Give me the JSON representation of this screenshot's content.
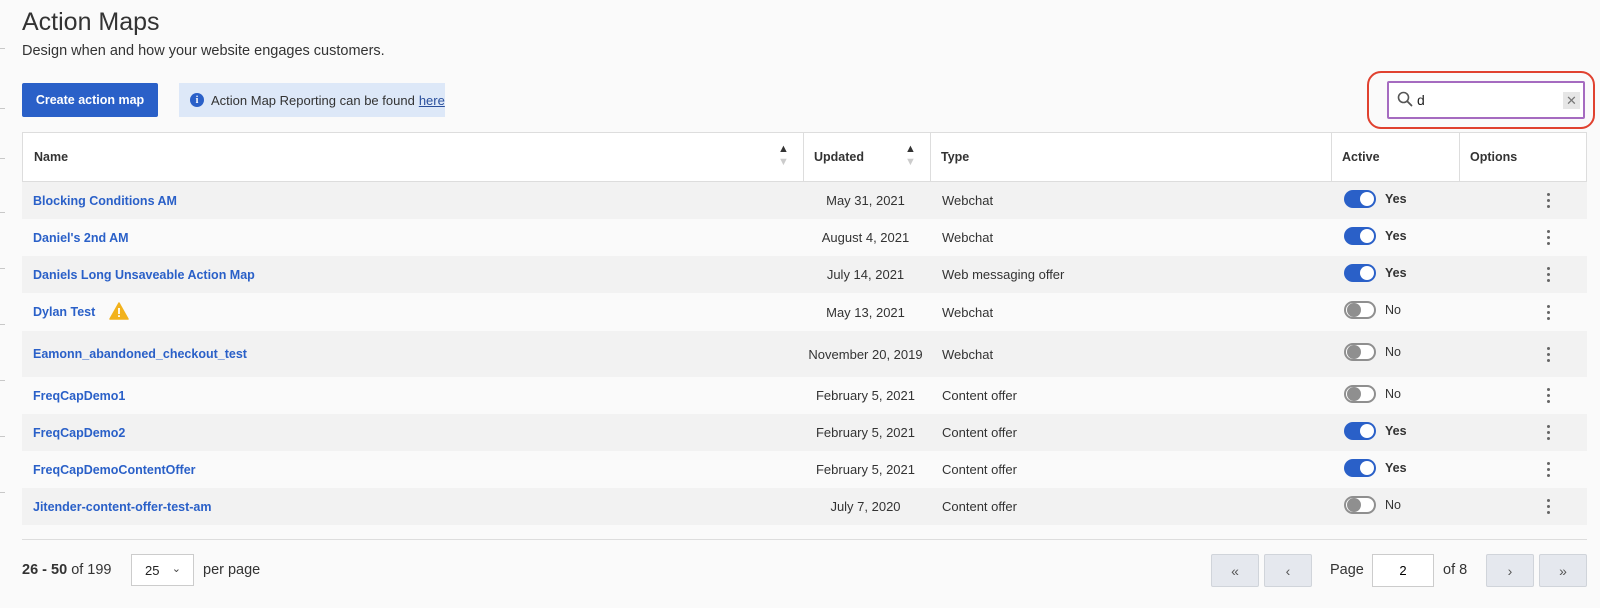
{
  "page": {
    "title": "Action Maps",
    "subtitle": "Design when and how your website engages customers."
  },
  "toolbar": {
    "create_label": "Create action map",
    "info_text": "Action Map Reporting can be found",
    "info_link": "here",
    "info_icon_glyph": "i"
  },
  "search": {
    "value": "d",
    "clear_glyph": "✕",
    "placeholder": ""
  },
  "table": {
    "headers": {
      "name": "Name",
      "updated": "Updated",
      "type": "Type",
      "active": "Active",
      "options": "Options"
    },
    "sort_up_glyph": "▲",
    "sort_down_glyph": "▼",
    "rows": [
      {
        "name": "Blocking Conditions AM",
        "updated": "May 31, 2021",
        "type": "Webchat",
        "active": true,
        "active_label": "Yes",
        "warning": false
      },
      {
        "name": "Daniel's 2nd AM",
        "updated": "August 4, 2021",
        "type": "Webchat",
        "active": true,
        "active_label": "Yes",
        "warning": false
      },
      {
        "name": "Daniels Long Unsaveable Action Map",
        "updated": "July 14, 2021",
        "type": "Web messaging offer",
        "active": true,
        "active_label": "Yes",
        "warning": false
      },
      {
        "name": "Dylan Test",
        "updated": "May 13, 2021",
        "type": "Webchat",
        "active": false,
        "active_label": "No",
        "warning": true
      },
      {
        "name": "Eamonn_abandoned_checkout_test",
        "updated": "November 20, 2019",
        "type": "Webchat",
        "active": false,
        "active_label": "No",
        "warning": false
      },
      {
        "name": "FreqCapDemo1",
        "updated": "February 5, 2021",
        "type": "Content offer",
        "active": false,
        "active_label": "No",
        "warning": false
      },
      {
        "name": "FreqCapDemo2",
        "updated": "February 5, 2021",
        "type": "Content offer",
        "active": true,
        "active_label": "Yes",
        "warning": false
      },
      {
        "name": "FreqCapDemoContentOffer",
        "updated": "February 5, 2021",
        "type": "Content offer",
        "active": true,
        "active_label": "Yes",
        "warning": false
      },
      {
        "name": "Jitender-content-offer-test-am",
        "updated": "July 7, 2020",
        "type": "Content offer",
        "active": false,
        "active_label": "No",
        "warning": false
      }
    ]
  },
  "pagination": {
    "range": "26 - 50",
    "of_total": "of 199",
    "per_page_value": "25",
    "per_page_label": "per page",
    "page_label": "Page",
    "current_page": "2",
    "total_pages_label": "of 8",
    "first_glyph": "«",
    "prev_glyph": "‹",
    "next_glyph": "›",
    "last_glyph": "»",
    "chevron_glyph": "⌄"
  },
  "colors": {
    "accent": "#2a60c8",
    "info_banner_bg": "#dde8f8",
    "focus_border": "#a56bc0",
    "highlight_ring": "#e0412f",
    "warning": "#f2b21c"
  },
  "icons": [
    "search-icon",
    "info-icon",
    "warning-icon",
    "kebab-menu-icon",
    "sort-icon",
    "close-icon",
    "chevron-down-icon"
  ]
}
